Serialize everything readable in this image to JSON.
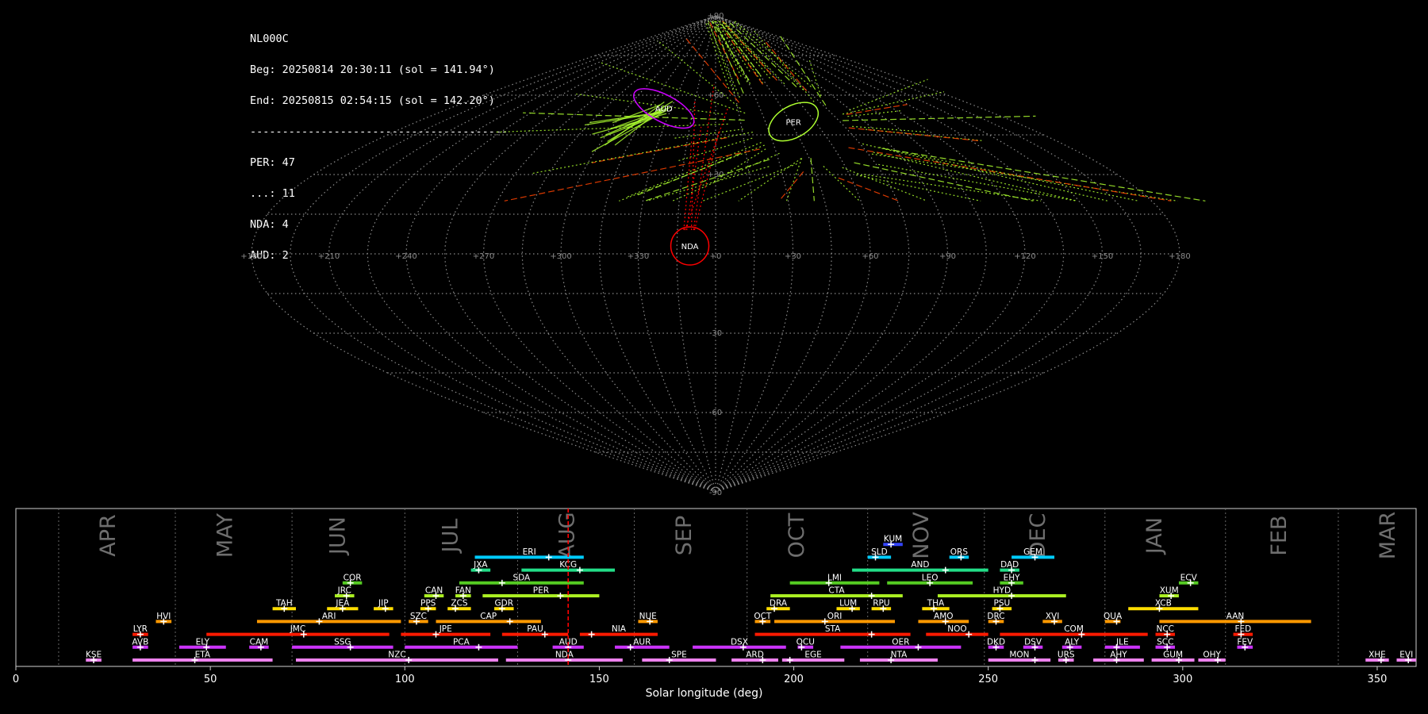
{
  "summary": {
    "station": "NL000C",
    "begin": "Beg: 20250814 20:30:11 (sol = 141.94°)",
    "end": "End: 20250815 02:54:15 (sol = 142.20°)",
    "separator": "----------------------------------------",
    "counts": [
      "PER: 47",
      "...: 11",
      "NDA: 4",
      "AUD: 2"
    ]
  },
  "sky_map": {
    "projection": "sinusoidal",
    "lon_labels": [
      "+180",
      "+150",
      "+120",
      "+90",
      "+60",
      "+30",
      "+0",
      "+330",
      "+300",
      "+270",
      "+240",
      "+210",
      "+180"
    ],
    "lat_labels": [
      "+90",
      "+60",
      "+30",
      "-30",
      "-60",
      "-90"
    ],
    "radiants": [
      {
        "name": "PER",
        "lon": 47,
        "lat": 50,
        "color": "#adff2f"
      },
      {
        "name": "AUD",
        "lon": -35,
        "lat": 55,
        "color": "#cc00ff"
      },
      {
        "name": "NDA",
        "lon": -10,
        "lat": 3,
        "color": "#ff0000"
      }
    ],
    "colors": {
      "PER": "#adff2f",
      "spor": "#ff4400",
      "AUD": "#cc00ff",
      "NDA": "#ff0000"
    }
  },
  "chart_data": {
    "type": "timeline",
    "xlabel": "Solar longitude (deg)",
    "xlim": [
      0,
      360
    ],
    "xticks": [
      0,
      50,
      100,
      150,
      200,
      250,
      300,
      350
    ],
    "current_sol": 142,
    "months": [
      {
        "label": "APR",
        "boundary": 11,
        "center": 24
      },
      {
        "label": "MAY",
        "boundary": 41,
        "center": 54
      },
      {
        "label": "JUN",
        "boundary": 71,
        "center": 83
      },
      {
        "label": "JUL",
        "boundary": 100,
        "center": 112
      },
      {
        "label": "AUG",
        "boundary": 129,
        "center": 142
      },
      {
        "label": "SEP",
        "boundary": 159,
        "center": 172
      },
      {
        "label": "OCT",
        "boundary": 188,
        "center": 201
      },
      {
        "label": "NOV",
        "boundary": 219,
        "center": 233
      },
      {
        "label": "DEC",
        "boundary": 249,
        "center": 263
      },
      {
        "label": "JAN",
        "boundary": 280,
        "center": 293
      },
      {
        "label": "FEB",
        "boundary": 311,
        "center": 325
      },
      {
        "label": "MAR",
        "boundary": 340,
        "center": 353
      }
    ],
    "showers": [
      {
        "code": "KSE",
        "row": 0,
        "start": 18,
        "end": 22,
        "peak": 20,
        "color": "#ee82ee"
      },
      {
        "code": "ETA",
        "row": 0,
        "start": 30,
        "end": 66,
        "peak": 46,
        "color": "#ee82ee"
      },
      {
        "code": "NZC",
        "row": 0,
        "start": 72,
        "end": 124,
        "peak": 101,
        "color": "#ee82ee"
      },
      {
        "code": "NDA",
        "row": 0,
        "start": 126,
        "end": 156,
        "peak": 142,
        "color": "#ee82ee"
      },
      {
        "code": "SPE",
        "row": 0,
        "start": 161,
        "end": 180,
        "peak": 168,
        "color": "#ee82ee"
      },
      {
        "code": "ARD",
        "row": 0,
        "start": 184,
        "end": 196,
        "peak": 192,
        "color": "#ee82ee"
      },
      {
        "code": "EGE",
        "row": 0,
        "start": 197,
        "end": 213,
        "peak": 199,
        "color": "#ee82ee"
      },
      {
        "code": "NTA",
        "row": 0,
        "start": 217,
        "end": 237,
        "peak": 225,
        "color": "#ee82ee"
      },
      {
        "code": "MON",
        "row": 0,
        "start": 250,
        "end": 266,
        "peak": 262,
        "color": "#ee82ee"
      },
      {
        "code": "URS",
        "row": 0,
        "start": 268,
        "end": 272,
        "peak": 270,
        "color": "#ee82ee"
      },
      {
        "code": "AHY",
        "row": 0,
        "start": 277,
        "end": 290,
        "peak": 283,
        "color": "#ee82ee"
      },
      {
        "code": "GUM",
        "row": 0,
        "start": 292,
        "end": 303,
        "peak": 299,
        "color": "#ee82ee"
      },
      {
        "code": "OHY",
        "row": 0,
        "start": 304,
        "end": 311,
        "peak": 309,
        "color": "#ee82ee"
      },
      {
        "code": "XHE",
        "row": 0,
        "start": 347,
        "end": 353,
        "peak": 351,
        "color": "#ee82ee"
      },
      {
        "code": "EVI",
        "row": 0,
        "start": 355,
        "end": 360,
        "peak": 358,
        "color": "#ee82ee"
      },
      {
        "code": "AVB",
        "row": 1,
        "start": 30,
        "end": 34,
        "peak": 32,
        "color": "#cc33ff"
      },
      {
        "code": "ELY",
        "row": 1,
        "start": 42,
        "end": 54,
        "peak": 49,
        "color": "#cc33ff"
      },
      {
        "code": "CAM",
        "row": 1,
        "start": 60,
        "end": 65,
        "peak": 63,
        "color": "#cc33ff"
      },
      {
        "code": "SSG",
        "row": 1,
        "start": 71,
        "end": 97,
        "peak": 86,
        "color": "#cc33ff"
      },
      {
        "code": "PCA",
        "row": 1,
        "start": 100,
        "end": 129,
        "peak": 119,
        "color": "#cc33ff"
      },
      {
        "code": "AUD",
        "row": 1,
        "start": 138,
        "end": 146,
        "peak": 142,
        "color": "#cc33ff"
      },
      {
        "code": "AUR",
        "row": 1,
        "start": 154,
        "end": 168,
        "peak": 158,
        "color": "#cc33ff"
      },
      {
        "code": "DSX",
        "row": 1,
        "start": 174,
        "end": 198,
        "peak": 187,
        "color": "#cc33ff"
      },
      {
        "code": "OCU",
        "row": 1,
        "start": 201,
        "end": 205,
        "peak": 202,
        "color": "#cc33ff"
      },
      {
        "code": "OER",
        "row": 1,
        "start": 212,
        "end": 243,
        "peak": 232,
        "color": "#cc33ff"
      },
      {
        "code": "DKD",
        "row": 1,
        "start": 250,
        "end": 254,
        "peak": 252,
        "color": "#cc33ff"
      },
      {
        "code": "DSV",
        "row": 1,
        "start": 259,
        "end": 264,
        "peak": 262,
        "color": "#cc33ff"
      },
      {
        "code": "ALY",
        "row": 1,
        "start": 269,
        "end": 274,
        "peak": 271,
        "color": "#cc33ff"
      },
      {
        "code": "JLE",
        "row": 1,
        "start": 280,
        "end": 289,
        "peak": 283,
        "color": "#cc33ff"
      },
      {
        "code": "SCC",
        "row": 1,
        "start": 293,
        "end": 298,
        "peak": 296,
        "color": "#cc33ff"
      },
      {
        "code": "FEV",
        "row": 1,
        "start": 314,
        "end": 318,
        "peak": 316,
        "color": "#cc33ff"
      },
      {
        "code": "LYR",
        "row": 2,
        "start": 30,
        "end": 34,
        "peak": 32,
        "color": "#ff1a00"
      },
      {
        "code": "JMC",
        "row": 2,
        "start": 49,
        "end": 96,
        "peak": 74,
        "color": "#ff1a00"
      },
      {
        "code": "JPE",
        "row": 2,
        "start": 99,
        "end": 122,
        "peak": 108,
        "color": "#ff1a00"
      },
      {
        "code": "PAU",
        "row": 2,
        "start": 125,
        "end": 142,
        "peak": 136,
        "color": "#ff1a00"
      },
      {
        "code": "NIA",
        "row": 2,
        "start": 145,
        "end": 165,
        "peak": 148,
        "color": "#ff1a00"
      },
      {
        "code": "STA",
        "row": 2,
        "start": 190,
        "end": 230,
        "peak": 220,
        "color": "#ff1a00"
      },
      {
        "code": "NOO",
        "row": 2,
        "start": 234,
        "end": 250,
        "peak": 245,
        "color": "#ff1a00"
      },
      {
        "code": "COM",
        "row": 2,
        "start": 253,
        "end": 291,
        "peak": 274,
        "color": "#ff1a00"
      },
      {
        "code": "NCC",
        "row": 2,
        "start": 293,
        "end": 298,
        "peak": 296,
        "color": "#ff1a00"
      },
      {
        "code": "FED",
        "row": 2,
        "start": 313,
        "end": 318,
        "peak": 315,
        "color": "#ff1a00"
      },
      {
        "code": "HVI",
        "row": 3,
        "start": 36,
        "end": 40,
        "peak": 38,
        "color": "#ff9900"
      },
      {
        "code": "ARI",
        "row": 3,
        "start": 62,
        "end": 99,
        "peak": 78,
        "color": "#ff9900"
      },
      {
        "code": "SZC",
        "row": 3,
        "start": 101,
        "end": 106,
        "peak": 103,
        "color": "#ff9900"
      },
      {
        "code": "CAP",
        "row": 3,
        "start": 108,
        "end": 135,
        "peak": 127,
        "color": "#ff9900"
      },
      {
        "code": "NUE",
        "row": 3,
        "start": 160,
        "end": 165,
        "peak": 163,
        "color": "#ff9900"
      },
      {
        "code": "OCT",
        "row": 3,
        "start": 190,
        "end": 194,
        "peak": 192,
        "color": "#ff9900"
      },
      {
        "code": "ORI",
        "row": 3,
        "start": 195,
        "end": 226,
        "peak": 208,
        "color": "#ff9900"
      },
      {
        "code": "AMO",
        "row": 3,
        "start": 232,
        "end": 245,
        "peak": 239,
        "color": "#ff9900"
      },
      {
        "code": "DRC",
        "row": 3,
        "start": 250,
        "end": 254,
        "peak": 252,
        "color": "#ff9900"
      },
      {
        "code": "XVI",
        "row": 3,
        "start": 264,
        "end": 269,
        "peak": 267,
        "color": "#ff9900"
      },
      {
        "code": "QUA",
        "row": 3,
        "start": 280,
        "end": 284,
        "peak": 283,
        "color": "#ff9900"
      },
      {
        "code": "AAN",
        "row": 3,
        "start": 294,
        "end": 333,
        "peak": 315,
        "color": "#ff9900"
      },
      {
        "code": "TAH",
        "row": 4,
        "start": 66,
        "end": 72,
        "peak": 69,
        "color": "#ffdd00"
      },
      {
        "code": "JEA",
        "row": 4,
        "start": 80,
        "end": 88,
        "peak": 84,
        "color": "#ffdd00"
      },
      {
        "code": "JIP",
        "row": 4,
        "start": 92,
        "end": 97,
        "peak": 95,
        "color": "#ffdd00"
      },
      {
        "code": "PPS",
        "row": 4,
        "start": 104,
        "end": 108,
        "peak": 106,
        "color": "#ffdd00"
      },
      {
        "code": "ZCS",
        "row": 4,
        "start": 111,
        "end": 117,
        "peak": 113,
        "color": "#ffdd00"
      },
      {
        "code": "GDR",
        "row": 4,
        "start": 123,
        "end": 128,
        "peak": 125,
        "color": "#ffdd00"
      },
      {
        "code": "DRA",
        "row": 4,
        "start": 193,
        "end": 199,
        "peak": 195,
        "color": "#ffdd00"
      },
      {
        "code": "LUM",
        "row": 4,
        "start": 211,
        "end": 217,
        "peak": 215,
        "color": "#ffdd00"
      },
      {
        "code": "RPU",
        "row": 4,
        "start": 220,
        "end": 225,
        "peak": 223,
        "color": "#ffdd00"
      },
      {
        "code": "THA",
        "row": 4,
        "start": 233,
        "end": 240,
        "peak": 236,
        "color": "#ffdd00"
      },
      {
        "code": "PSU",
        "row": 4,
        "start": 251,
        "end": 256,
        "peak": 253,
        "color": "#ffdd00"
      },
      {
        "code": "XCB",
        "row": 4,
        "start": 286,
        "end": 304,
        "peak": 294,
        "color": "#ffdd00"
      },
      {
        "code": "JRC",
        "row": 5,
        "start": 82,
        "end": 87,
        "peak": 85,
        "color": "#aaee22"
      },
      {
        "code": "CAN",
        "row": 5,
        "start": 105,
        "end": 110,
        "peak": 108,
        "color": "#aaee22"
      },
      {
        "code": "FAN",
        "row": 5,
        "start": 113,
        "end": 117,
        "peak": 115,
        "color": "#aaee22"
      },
      {
        "code": "PER",
        "row": 5,
        "start": 120,
        "end": 150,
        "peak": 140,
        "color": "#aaee22"
      },
      {
        "code": "CTA",
        "row": 5,
        "start": 194,
        "end": 228,
        "peak": 220,
        "color": "#aaee22"
      },
      {
        "code": "HYD",
        "row": 5,
        "start": 237,
        "end": 270,
        "peak": 256,
        "color": "#aaee22"
      },
      {
        "code": "XUM",
        "row": 5,
        "start": 294,
        "end": 299,
        "peak": 297,
        "color": "#aaee22"
      },
      {
        "code": "SDA",
        "row": 6,
        "start": 114,
        "end": 146,
        "peak": 125,
        "color": "#55cc22"
      },
      {
        "code": "LMI",
        "row": 6,
        "start": 199,
        "end": 222,
        "peak": 209,
        "color": "#55cc22"
      },
      {
        "code": "LEO",
        "row": 6,
        "start": 224,
        "end": 246,
        "peak": 235,
        "color": "#55cc22"
      },
      {
        "code": "EHY",
        "row": 6,
        "start": 253,
        "end": 259,
        "peak": 256,
        "color": "#55cc22"
      },
      {
        "code": "COR",
        "row": 6,
        "start": 84,
        "end": 89,
        "peak": 86,
        "color": "#55cc22"
      },
      {
        "code": "ECV",
        "row": 6,
        "start": 299,
        "end": 304,
        "peak": 302,
        "color": "#55cc22"
      },
      {
        "code": "JXA",
        "row": 7,
        "start": 117,
        "end": 122,
        "peak": 119,
        "color": "#22dd88"
      },
      {
        "code": "KCG",
        "row": 7,
        "start": 130,
        "end": 154,
        "peak": 145,
        "color": "#22dd88"
      },
      {
        "code": "AND",
        "row": 7,
        "start": 215,
        "end": 250,
        "peak": 239,
        "color": "#22dd88"
      },
      {
        "code": "DAD",
        "row": 7,
        "start": 253,
        "end": 258,
        "peak": 256,
        "color": "#22dd88"
      },
      {
        "code": "ERI",
        "row": 8,
        "start": 118,
        "end": 146,
        "peak": 137,
        "color": "#00ccff"
      },
      {
        "code": "SLD",
        "row": 8,
        "start": 219,
        "end": 225,
        "peak": 221,
        "color": "#00ccff"
      },
      {
        "code": "ORS",
        "row": 8,
        "start": 240,
        "end": 245,
        "peak": 243,
        "color": "#00ccff"
      },
      {
        "code": "GEM",
        "row": 8,
        "start": 256,
        "end": 267,
        "peak": 262,
        "color": "#00ccff"
      },
      {
        "code": "KUM",
        "row": 9,
        "start": 223,
        "end": 228,
        "peak": 225,
        "color": "#3344ff"
      }
    ]
  }
}
